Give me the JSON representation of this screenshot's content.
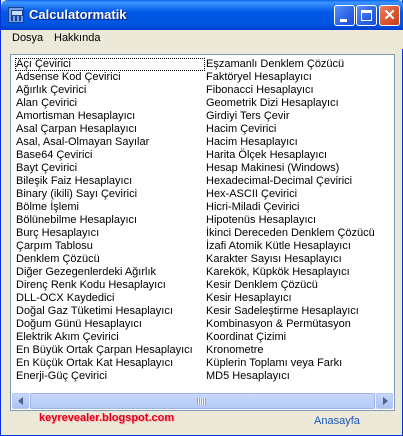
{
  "window": {
    "title": "Calculatormatik"
  },
  "menu": {
    "items": [
      "Dosya",
      "Hakkında"
    ]
  },
  "list": {
    "left_column": [
      "Açı Çevirici",
      "Adsense Kod Çevirici",
      "Ağırlık Çevirici",
      "Alan Çevirici",
      "Amortisman Hesaplayıcı",
      "Asal Çarpan Hesaplayıcı",
      "Asal, Asal-Olmayan Sayılar",
      "Base64 Çevirici",
      "Bayt Çevirici",
      "Bileşik Faiz Hesaplayıcı",
      "Binary (ikili) Sayı Çevirici",
      "Bölme İşlemi",
      "Bölünebilme Hesaplayıcı",
      "Burç Hesaplayıcı",
      "Çarpım Tablosu",
      "Denklem Çözücü",
      "Diğer Gezegenlerdeki Ağırlık",
      "Direnç Renk Kodu Hesaplayıcı",
      "DLL-OCX Kaydedici",
      "Doğal Gaz Tüketimi Hesaplayıcı",
      "Doğum Günü Hesaplayıcı",
      "Elektrik Akım Çevirici",
      "En Büyük Ortak Çarpan Hesaplayıcı",
      "En Küçük Ortak Kat Hesaplayıcı",
      "Enerji-Güç Çevirici"
    ],
    "right_column": [
      "Eşzamanlı Denklem Çözücü",
      "Faktöryel Hesaplayıcı",
      "Fibonacci Hesaplayıcı",
      "Geometrik Dizi Hesaplayıcı",
      "Girdiyi Ters Çevir",
      "Hacim Çevirici",
      "Hacim Hesaplayıcı",
      "Harita Ölçek Hesaplayıcı",
      "Hesap Makinesi (Windows)",
      "Hexadecimal-Decimal Çevirici",
      "Hex-ASCII Çevirici",
      "Hicri-Miladi Çevirici",
      "Hipotenüs Hesaplayıcı",
      "İkinci Dereceden Denklem Çözücü",
      "İzafi Atomik Kütle Hesaplayıcı",
      "Karakter Sayısı Hesaplayıcı",
      "Karekök, Küpkök Hesaplayıcı",
      "Kesir Denklem Çözücü",
      "Kesir Hesaplayıcı",
      "Kesir Sadeleştirme Hesaplayıcı",
      "Kombinasyon & Permütasyon",
      "Koordinat Çizimi",
      "Kronometre",
      "Küplerin Toplamı veya Farkı",
      "MD5 Hesaplayıcı"
    ],
    "selected_item": "Açı Çevirici"
  },
  "footer": {
    "blog_link": "keyrevealer.blogspot.com",
    "home_link": "Anasayfa"
  },
  "colors": {
    "title_bar": "#0055e0",
    "blog_link": "#e0001a",
    "home_link": "#1a55b8"
  }
}
